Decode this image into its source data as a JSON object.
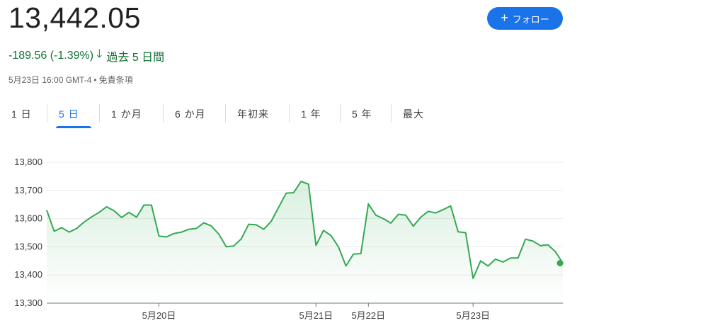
{
  "header": {
    "price": "13,442.05",
    "change": "-189.56 (-1.39%)",
    "period": "過去 5 日間",
    "timestamp": "5月23日 16:00 GMT-4",
    "disclaimer": "免責条項",
    "follow_label": "フォロー"
  },
  "colors": {
    "accent": "#1a73e8",
    "positive_text": "#137333",
    "line": "#34a853"
  },
  "tabs": [
    {
      "label": "1 日",
      "active": false
    },
    {
      "label": "5 日",
      "active": true
    },
    {
      "label": "1 か月",
      "active": false
    },
    {
      "label": "6 か月",
      "active": false
    },
    {
      "label": "年初来",
      "active": false
    },
    {
      "label": "1 年",
      "active": false
    },
    {
      "label": "5 年",
      "active": false
    },
    {
      "label": "最大",
      "active": false
    }
  ],
  "chart_data": {
    "type": "area",
    "x_tick_labels": [
      "5月20日",
      "5月21日",
      "5月22日",
      "5月23日"
    ],
    "y_tick_labels": [
      "13,800",
      "13,700",
      "13,600",
      "13,500",
      "13,400",
      "13,300"
    ],
    "y_ticks": [
      13800,
      13700,
      13600,
      13500,
      13400,
      13300
    ],
    "ylim": [
      13300,
      13800
    ],
    "grid": true,
    "last_value": 13442.05,
    "values": [
      13630,
      13555,
      13568,
      13552,
      13565,
      13588,
      13606,
      13622,
      13642,
      13628,
      13604,
      13622,
      13605,
      13648,
      13648,
      13538,
      13535,
      13547,
      13552,
      13562,
      13565,
      13585,
      13574,
      13545,
      13500,
      13503,
      13528,
      13580,
      13578,
      13562,
      13590,
      13640,
      13690,
      13692,
      13732,
      13722,
      13505,
      13558,
      13540,
      13500,
      13432,
      13474,
      13476,
      13652,
      13612,
      13600,
      13584,
      13615,
      13612,
      13573,
      13605,
      13626,
      13620,
      13632,
      13645,
      13553,
      13550,
      13388,
      13450,
      13432,
      13456,
      13446,
      13460,
      13460,
      13527,
      13520,
      13504,
      13507,
      13483,
      13442
    ]
  }
}
